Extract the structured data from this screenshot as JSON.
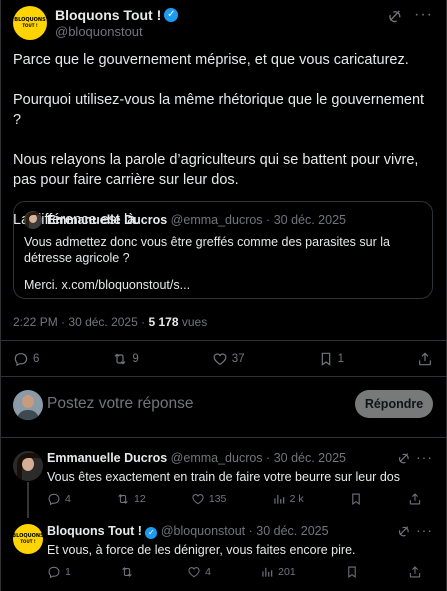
{
  "post": {
    "author_name": "Bloquons Tout !",
    "author_handle": "@bloquonstout",
    "avatar_line1": "BLOQUONS",
    "avatar_line2": "TOUT !",
    "paragraphs": [
      "Parce que le gouvernement méprise, et que vous caricaturez.",
      "Pourquoi utilisez-vous la même rhétorique que le gouvernement ?",
      "Nous relayons la parole d’agriculteurs qui se battent pour vivre, pas pour faire carrière sur leur dos.",
      "La différence est là."
    ],
    "quote": {
      "author_name": "Emmanuelle Ducros",
      "author_handle": "@emma_ducros",
      "separator": "·",
      "date": "30 déc. 2025",
      "text": "Vous admettez donc vous être greffés comme des parasites sur la détresse agricole ?",
      "link": "Merci. x.com/bloquonstout/s..."
    },
    "meta": {
      "time": "2:22 PM",
      "separator": "·",
      "date": "30 déc. 2025",
      "views_count": "5 178",
      "views_label": "vues"
    },
    "stats": {
      "replies": "6",
      "reposts": "9",
      "likes": "37",
      "bookmarks": "1"
    }
  },
  "composer": {
    "placeholder": "Postez votre réponse",
    "button_label": "Répondre"
  },
  "replies": [
    {
      "author_name": "Emmanuelle Ducros",
      "author_handle": "@emma_ducros",
      "separator": "·",
      "date": "30 déc. 2025",
      "text": "Vous êtes exactement en train de faire votre beurre sur leur dos",
      "stats": {
        "replies": "4",
        "reposts": "12",
        "likes": "135",
        "views": "2 k"
      }
    },
    {
      "author_name": "Bloquons Tout !",
      "author_handle": "@bloquonstout",
      "separator": "·",
      "date": "30 déc. 2025",
      "text": "Et vous, à force de les dénigrer, vous faites encore pire.",
      "stats": {
        "replies": "1",
        "reposts": "",
        "likes": "4",
        "views": "201"
      }
    }
  ],
  "icons": {
    "verified": "verified-badge-icon",
    "grok": "grok-icon",
    "more": "more-icon",
    "reply": "reply-icon",
    "repost": "repost-icon",
    "like": "heart-icon",
    "bookmark": "bookmark-icon",
    "share": "share-icon",
    "views": "views-icon"
  },
  "colors": {
    "background": "#000000",
    "text": "#e7e9ea",
    "secondary_text": "#71767b",
    "border": "#2f3336",
    "verified": "#1d9bf0",
    "avatar_yellow": "#ffd400",
    "button_disabled": "#787a7a"
  }
}
